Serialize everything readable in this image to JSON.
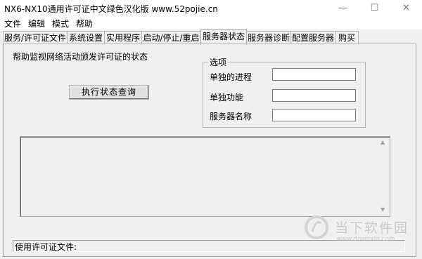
{
  "window": {
    "title": "NX6-NX10通用许可证中文绿色汉化版 www.52pojie.cn",
    "minimize": "—",
    "maximize": "☐",
    "close": "✕"
  },
  "menu": {
    "items": [
      "文件",
      "编辑",
      "模式",
      "帮助"
    ]
  },
  "tabs": [
    {
      "label": "服务/许可证文件"
    },
    {
      "label": "系统设置"
    },
    {
      "label": "实用程序"
    },
    {
      "label": "启动/停止/重启"
    },
    {
      "label": "服务器状态",
      "active": true
    },
    {
      "label": "服务器诊断"
    },
    {
      "label": "配置服务器"
    },
    {
      "label": "购买"
    }
  ],
  "panel": {
    "help_text": "帮助监视网络活动颁发许可证的状态",
    "exec_button": "执行状态查询",
    "options": {
      "legend": "选项",
      "fields": [
        {
          "label": "单独的进程",
          "value": ""
        },
        {
          "label": "单独功能",
          "value": ""
        },
        {
          "label": "服务器名称",
          "value": ""
        }
      ]
    },
    "output": ""
  },
  "status": {
    "text": "使用许可证文件:"
  },
  "watermark": {
    "text": "当下软件园",
    "url": "www.downxia.com"
  }
}
